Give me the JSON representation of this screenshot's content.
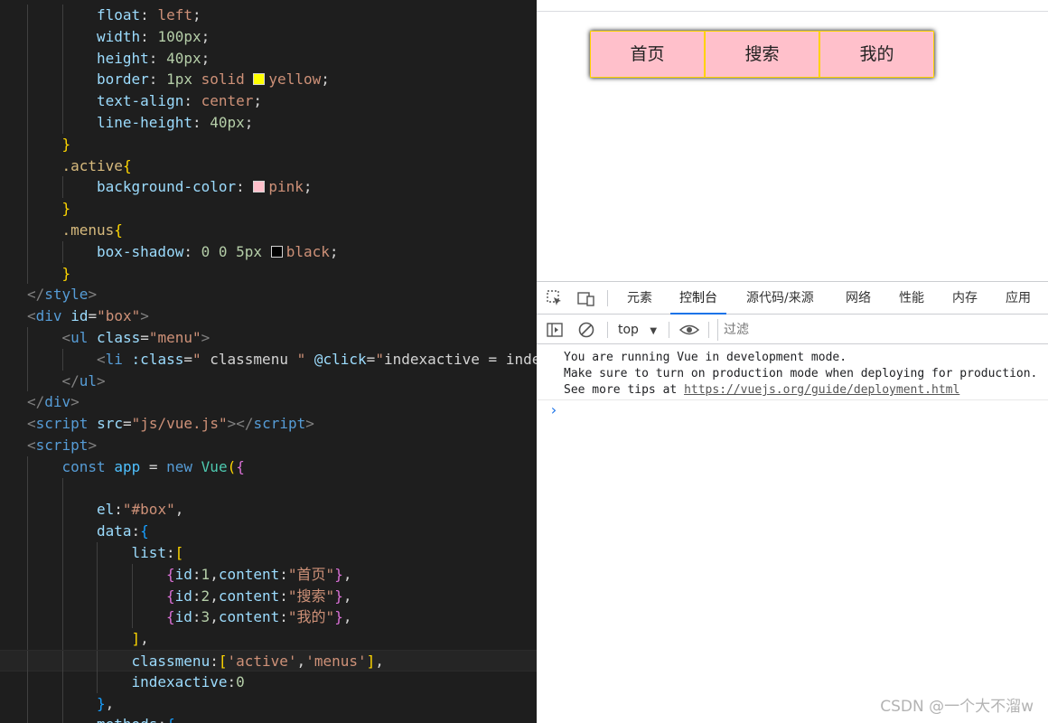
{
  "editor": {
    "lines": [
      {
        "indent": 2,
        "segs": [
          [
            "c-prop",
            "float"
          ],
          [
            "c-pun",
            ": "
          ],
          [
            "c-val",
            "left"
          ],
          [
            "c-pun",
            ";"
          ]
        ]
      },
      {
        "indent": 2,
        "segs": [
          [
            "c-prop",
            "width"
          ],
          [
            "c-pun",
            ": "
          ],
          [
            "c-num",
            "100px"
          ],
          [
            "c-pun",
            ";"
          ]
        ]
      },
      {
        "indent": 2,
        "segs": [
          [
            "c-prop",
            "height"
          ],
          [
            "c-pun",
            ": "
          ],
          [
            "c-num",
            "40px"
          ],
          [
            "c-pun",
            ";"
          ]
        ]
      },
      {
        "indent": 2,
        "segs": [
          [
            "c-prop",
            "border"
          ],
          [
            "c-pun",
            ": "
          ],
          [
            "c-num",
            "1px"
          ],
          [
            "c-pun",
            " "
          ],
          [
            "c-val",
            "solid"
          ],
          [
            "c-pun",
            " "
          ],
          [
            "swatch",
            "#ffff00"
          ],
          [
            "c-val",
            "yellow"
          ],
          [
            "c-pun",
            ";"
          ]
        ]
      },
      {
        "indent": 2,
        "segs": [
          [
            "c-prop",
            "text-align"
          ],
          [
            "c-pun",
            ": "
          ],
          [
            "c-val",
            "center"
          ],
          [
            "c-pun",
            ";"
          ]
        ]
      },
      {
        "indent": 2,
        "segs": [
          [
            "c-prop",
            "line-height"
          ],
          [
            "c-pun",
            ": "
          ],
          [
            "c-num",
            "40px"
          ],
          [
            "c-pun",
            ";"
          ]
        ]
      },
      {
        "indent": 1,
        "segs": [
          [
            "c-br1",
            "}"
          ]
        ]
      },
      {
        "indent": 1,
        "segs": [
          [
            "c-sel",
            ".active"
          ],
          [
            "c-br1",
            "{"
          ]
        ]
      },
      {
        "indent": 2,
        "segs": [
          [
            "c-prop",
            "background-color"
          ],
          [
            "c-pun",
            ": "
          ],
          [
            "swatch",
            "#ffc0cb"
          ],
          [
            "c-val",
            "pink"
          ],
          [
            "c-pun",
            ";"
          ]
        ]
      },
      {
        "indent": 1,
        "segs": [
          [
            "c-br1",
            "}"
          ]
        ]
      },
      {
        "indent": 1,
        "segs": [
          [
            "c-sel",
            ".menus"
          ],
          [
            "c-br1",
            "{"
          ]
        ]
      },
      {
        "indent": 2,
        "segs": [
          [
            "c-prop",
            "box-shadow"
          ],
          [
            "c-pun",
            ": "
          ],
          [
            "c-num",
            "0"
          ],
          [
            "c-pun",
            " "
          ],
          [
            "c-num",
            "0"
          ],
          [
            "c-pun",
            " "
          ],
          [
            "c-num",
            "5px"
          ],
          [
            "c-pun",
            " "
          ],
          [
            "swatch",
            "#000000"
          ],
          [
            "c-val",
            "black"
          ],
          [
            "c-pun",
            ";"
          ]
        ]
      },
      {
        "indent": 1,
        "segs": [
          [
            "c-br1",
            "}"
          ]
        ]
      },
      {
        "indent": 0,
        "segs": [
          [
            "c-tag",
            "</"
          ],
          [
            "c-tagn",
            "style"
          ],
          [
            "c-tag",
            ">"
          ]
        ]
      },
      {
        "indent": 0,
        "segs": [
          [
            "c-tag",
            "<"
          ],
          [
            "c-tagn",
            "div"
          ],
          [
            "c-pun",
            " "
          ],
          [
            "c-attr",
            "id"
          ],
          [
            "c-pun",
            "="
          ],
          [
            "c-str",
            "\"box\""
          ],
          [
            "c-tag",
            ">"
          ]
        ]
      },
      {
        "indent": 1,
        "segs": [
          [
            "c-tag",
            "<"
          ],
          [
            "c-tagn",
            "ul"
          ],
          [
            "c-pun",
            " "
          ],
          [
            "c-attr",
            "class"
          ],
          [
            "c-pun",
            "="
          ],
          [
            "c-str",
            "\"menu\""
          ],
          [
            "c-tag",
            ">"
          ]
        ]
      },
      {
        "indent": 2,
        "segs": [
          [
            "c-tag",
            "<"
          ],
          [
            "c-tagn",
            "li"
          ],
          [
            "c-pun",
            " "
          ],
          [
            "c-attr",
            ":class"
          ],
          [
            "c-pun",
            "="
          ],
          [
            "c-str",
            "\""
          ],
          [
            "c-pun",
            " classmenu "
          ],
          [
            "c-str",
            "\""
          ],
          [
            "c-pun",
            " "
          ],
          [
            "c-attr",
            "@click"
          ],
          [
            "c-pun",
            "="
          ],
          [
            "c-str",
            "\""
          ],
          [
            "c-pun",
            "indexactive = inde"
          ]
        ]
      },
      {
        "indent": 1,
        "segs": [
          [
            "c-tag",
            "</"
          ],
          [
            "c-tagn",
            "ul"
          ],
          [
            "c-tag",
            ">"
          ]
        ]
      },
      {
        "indent": 0,
        "segs": [
          [
            "c-tag",
            "</"
          ],
          [
            "c-tagn",
            "div"
          ],
          [
            "c-tag",
            ">"
          ]
        ]
      },
      {
        "indent": 0,
        "segs": [
          [
            "c-tag",
            "<"
          ],
          [
            "c-tagn",
            "script"
          ],
          [
            "c-pun",
            " "
          ],
          [
            "c-attr",
            "src"
          ],
          [
            "c-pun",
            "="
          ],
          [
            "c-str",
            "\"js/vue.js\""
          ],
          [
            "c-tag",
            "></"
          ],
          [
            "c-tagn",
            "script"
          ],
          [
            "c-tag",
            ">"
          ]
        ]
      },
      {
        "indent": 0,
        "segs": [
          [
            "c-tag",
            "<"
          ],
          [
            "c-tagn",
            "script"
          ],
          [
            "c-tag",
            ">"
          ]
        ]
      },
      {
        "indent": 1,
        "segs": [
          [
            "c-kw",
            "const"
          ],
          [
            "c-pun",
            " "
          ],
          [
            "c-var",
            "app"
          ],
          [
            "c-pun",
            " = "
          ],
          [
            "c-kw",
            "new"
          ],
          [
            "c-pun",
            " "
          ],
          [
            "c-cls",
            "Vue"
          ],
          [
            "c-br1",
            "("
          ],
          [
            "c-br2",
            "{"
          ]
        ]
      },
      {
        "indent": 2,
        "segs": []
      },
      {
        "indent": 2,
        "segs": [
          [
            "c-id",
            "el"
          ],
          [
            "c-pun",
            ":"
          ],
          [
            "c-str",
            "\"#box\""
          ],
          [
            "c-pun",
            ","
          ]
        ]
      },
      {
        "indent": 2,
        "segs": [
          [
            "c-id",
            "data"
          ],
          [
            "c-pun",
            ":"
          ],
          [
            "c-br3",
            "{"
          ]
        ]
      },
      {
        "indent": 3,
        "segs": [
          [
            "c-id",
            "list"
          ],
          [
            "c-pun",
            ":"
          ],
          [
            "c-br1",
            "["
          ]
        ]
      },
      {
        "indent": 4,
        "segs": [
          [
            "c-br2",
            "{"
          ],
          [
            "c-id",
            "id"
          ],
          [
            "c-pun",
            ":"
          ],
          [
            "c-num",
            "1"
          ],
          [
            "c-pun",
            ","
          ],
          [
            "c-id",
            "content"
          ],
          [
            "c-pun",
            ":"
          ],
          [
            "c-str",
            "\"首页\""
          ],
          [
            "c-br2",
            "}"
          ],
          [
            "c-pun",
            ","
          ]
        ]
      },
      {
        "indent": 4,
        "segs": [
          [
            "c-br2",
            "{"
          ],
          [
            "c-id",
            "id"
          ],
          [
            "c-pun",
            ":"
          ],
          [
            "c-num",
            "2"
          ],
          [
            "c-pun",
            ","
          ],
          [
            "c-id",
            "content"
          ],
          [
            "c-pun",
            ":"
          ],
          [
            "c-str",
            "\"搜索\""
          ],
          [
            "c-br2",
            "}"
          ],
          [
            "c-pun",
            ","
          ]
        ]
      },
      {
        "indent": 4,
        "segs": [
          [
            "c-br2",
            "{"
          ],
          [
            "c-id",
            "id"
          ],
          [
            "c-pun",
            ":"
          ],
          [
            "c-num",
            "3"
          ],
          [
            "c-pun",
            ","
          ],
          [
            "c-id",
            "content"
          ],
          [
            "c-pun",
            ":"
          ],
          [
            "c-str",
            "\"我的\""
          ],
          [
            "c-br2",
            "}"
          ],
          [
            "c-pun",
            ","
          ]
        ]
      },
      {
        "indent": 3,
        "segs": [
          [
            "c-br1",
            "]"
          ],
          [
            "c-pun",
            ","
          ]
        ]
      },
      {
        "indent": 3,
        "segs": [
          [
            "c-id",
            "classmenu"
          ],
          [
            "c-pun",
            ":"
          ],
          [
            "c-br1",
            "["
          ],
          [
            "c-str",
            "'active'"
          ],
          [
            "c-pun",
            ","
          ],
          [
            "c-str",
            "'menus'"
          ],
          [
            "c-br1",
            "]"
          ],
          [
            "c-pun",
            ","
          ]
        ],
        "current": true
      },
      {
        "indent": 3,
        "segs": [
          [
            "c-id",
            "indexactive"
          ],
          [
            "c-pun",
            ":"
          ],
          [
            "c-num",
            "0"
          ]
        ]
      },
      {
        "indent": 2,
        "segs": [
          [
            "c-br3",
            "}"
          ],
          [
            "c-pun",
            ","
          ]
        ]
      },
      {
        "indent": 2,
        "segs": [
          [
            "c-id",
            "methods"
          ],
          [
            "c-pun",
            ":"
          ],
          [
            "c-br3",
            "{"
          ]
        ]
      }
    ]
  },
  "preview": {
    "menu_items": [
      "首页",
      "搜索",
      "我的"
    ]
  },
  "devtools": {
    "tabs": [
      "元素",
      "控制台",
      "源代码/来源",
      "网络",
      "性能",
      "内存",
      "应用"
    ],
    "active_tab": "控制台",
    "context": "top",
    "filter_placeholder": "过滤",
    "console_lines": [
      "You are running Vue in development mode.",
      "Make sure to turn on production mode when deploying for production.",
      "See more tips at "
    ],
    "console_link": "https://vuejs.org/guide/deployment.html",
    "prompt": "›"
  },
  "watermark": "CSDN @一个大不溜w"
}
